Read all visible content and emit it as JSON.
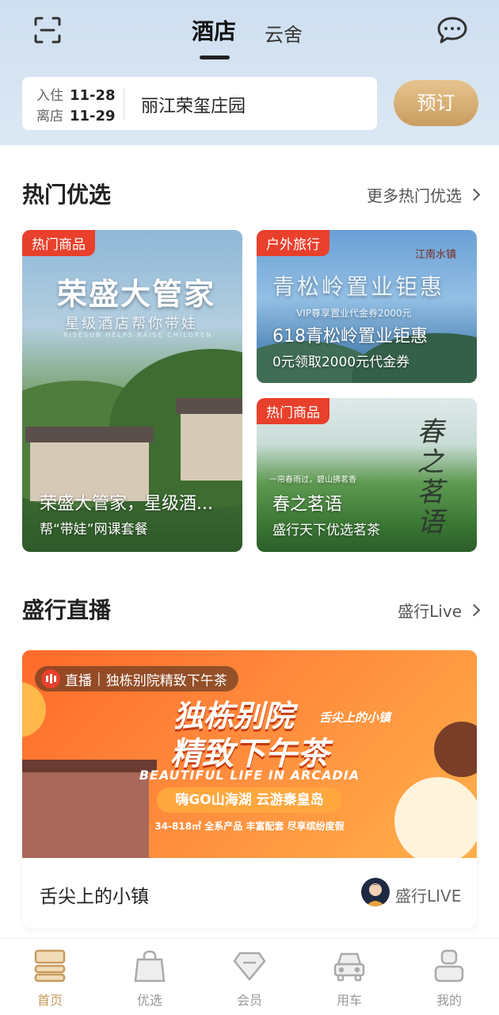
{
  "header": {
    "tabs": [
      "酒店",
      "云舍"
    ],
    "active_tab": "酒店"
  },
  "search": {
    "checkin_label": "入住",
    "checkin_date": "11-28",
    "checkout_label": "离店",
    "checkout_date": "11-29",
    "hotel": "丽江荣玺庄园",
    "book_label": "预订"
  },
  "hot": {
    "title": "热门优选",
    "more": "更多热门优选",
    "cards": [
      {
        "tag": "热门商品",
        "poster_title": "荣盛大管家",
        "poster_sub": "星级酒店帮你带娃",
        "poster_en": "RISESUN  HELPS RAISE  CHILDREN",
        "title": "荣盛大管家，星级酒...",
        "subtitle": "帮“带娃”网课套餐"
      },
      {
        "tag": "户外旅行",
        "poster_title": "青松岭置业钜惠",
        "poster_sub": "VIP尊享置业代金券2000元",
        "brand": "江南水镇",
        "title": "618青松岭置业钜惠",
        "subtitle": "0元领取2000元代金券"
      },
      {
        "tag": "热门商品",
        "poster_title": "春之茗语",
        "poster_sub": "一帘春雨过，碧山拂茗香",
        "title": "春之茗语",
        "subtitle": "盛行天下优选茗茶"
      }
    ]
  },
  "live": {
    "title": "盛行直播",
    "more": "盛行Live",
    "badge": "直播",
    "badge_title": "独栋别院精致下午茶",
    "banner_line1": "独栋别院",
    "banner_line2": "精致下午茶",
    "banner_side": "舌尖上的小镇",
    "banner_en": "BEAUTIFUL LIFE IN ARCADIA",
    "banner_pill": "嗨GO山海湖  云游秦皇岛",
    "banner_small": "34-818㎡  全系产品  丰富配套  尽享缤纷度假",
    "footer_title": "舌尖上的小镇",
    "brand": "盛行LIVE"
  },
  "tabbar": {
    "items": [
      "首页",
      "优选",
      "会员",
      "用车",
      "我的"
    ],
    "active": "首页"
  },
  "colors": {
    "accent_gold": "#c79a5c",
    "tag_red": "#e8402c",
    "live_orange": "#ff7a33"
  }
}
